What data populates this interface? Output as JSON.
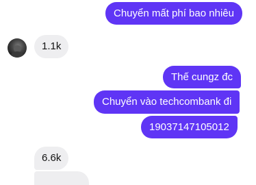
{
  "conversation": {
    "outgoing": [
      {
        "text": "Chuyển mất phí bao nhiêu"
      },
      {
        "text": "Thế cungz đc"
      },
      {
        "text": "Chuyển vào techcombank đi"
      },
      {
        "text": "19037147105012"
      }
    ],
    "incoming": [
      {
        "text": "1.1k"
      },
      {
        "text": "6.6k"
      }
    ]
  },
  "colors": {
    "outgoing_bubble": "#5f35f5",
    "incoming_bubble": "#eeeef0",
    "background": "#ffffff"
  }
}
